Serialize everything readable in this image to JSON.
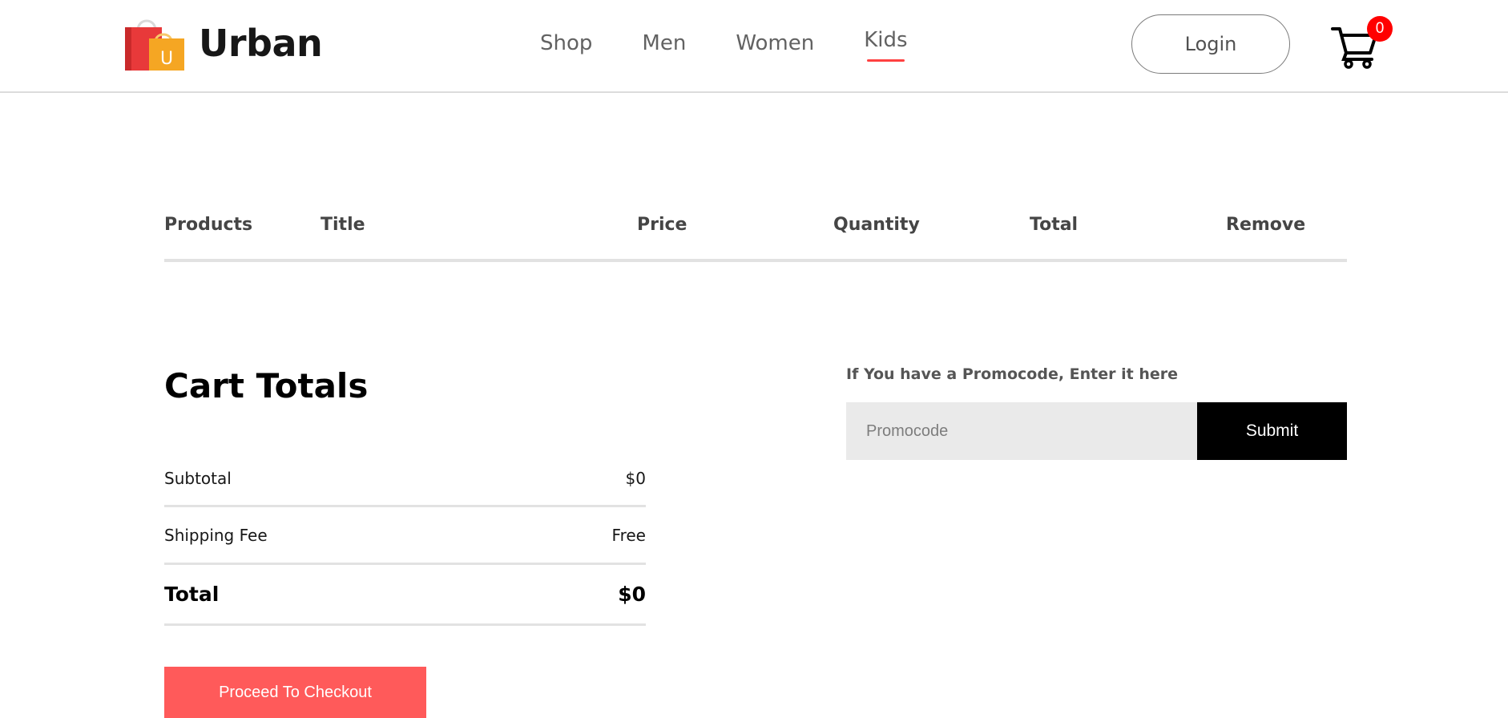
{
  "navbar": {
    "brand": "Urban",
    "logo_icon": "shopping-bag-icon",
    "logo_letter": "U",
    "menu": [
      {
        "label": "Shop",
        "active": false
      },
      {
        "label": "Men",
        "active": false
      },
      {
        "label": "Women",
        "active": false
      },
      {
        "label": "Kids",
        "active": true
      }
    ],
    "login_label": "Login",
    "cart_icon": "cart-icon",
    "cart_count": "0",
    "accent_color": "#ff4141"
  },
  "cart_table": {
    "headers": [
      "Products",
      "Title",
      "Price",
      "Quantity",
      "Total",
      "Remove"
    ],
    "rows": []
  },
  "cart_totals": {
    "title": "Cart Totals",
    "subtotal_label": "Subtotal",
    "subtotal_value": "$0",
    "shipping_label": "Shipping Fee",
    "shipping_value": "Free",
    "total_label": "Total",
    "total_value": "$0",
    "checkout_label": "Proceed To Checkout",
    "checkout_color": "#ff5a5a"
  },
  "promo": {
    "label": "If You have a Promocode, Enter it here",
    "placeholder": "Promocode",
    "value": "",
    "submit_label": "Submit"
  }
}
